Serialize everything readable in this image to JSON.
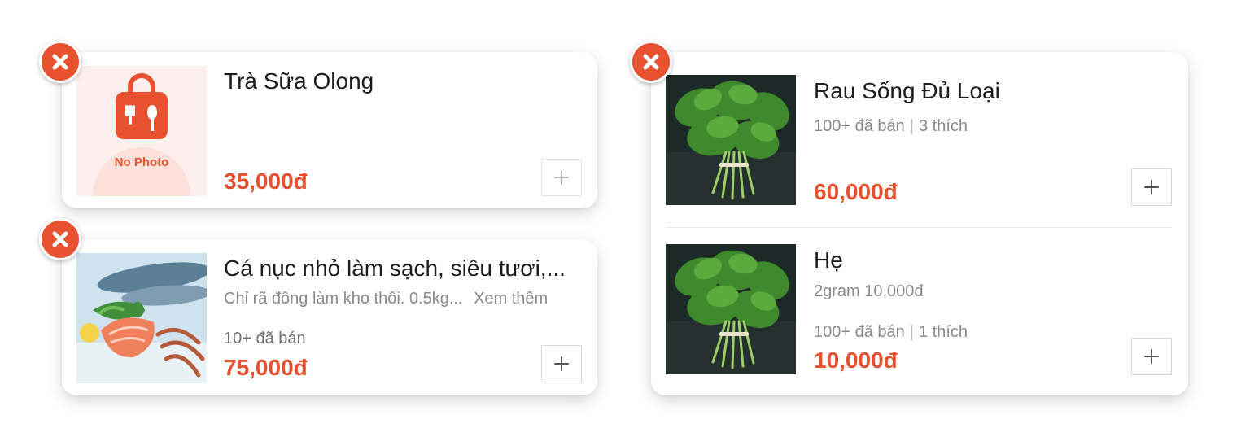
{
  "colors": {
    "accent": "#e8512f",
    "muted": "#8a8a8a",
    "card_bg": "#ffffff"
  },
  "remove_icon": "close-icon",
  "add_icon": "plus-icon",
  "cards": {
    "tra_sua": {
      "title": "Trà Sữa Olong",
      "price": "35,000đ",
      "image_placeholder_text": "No Photo"
    },
    "ca_nuc": {
      "title": "Cá nục nhỏ làm sạch, siêu tươi,...",
      "description": "Chỉ rã đông làm kho thôi. 0.5kg...",
      "see_more": "Xem thêm",
      "sold": "10+ đã bán",
      "price": "75,000đ"
    },
    "group": {
      "items": [
        {
          "title": "Rau Sống Đủ Loại",
          "sold": "100+ đã bán",
          "separator": "|",
          "likes": "3 thích",
          "price": "60,000đ"
        },
        {
          "title": "Hẹ",
          "note": "2gram 10,000đ",
          "sold": "100+ đã bán",
          "separator": "|",
          "likes": "1 thích",
          "price": "10,000đ"
        }
      ]
    }
  }
}
